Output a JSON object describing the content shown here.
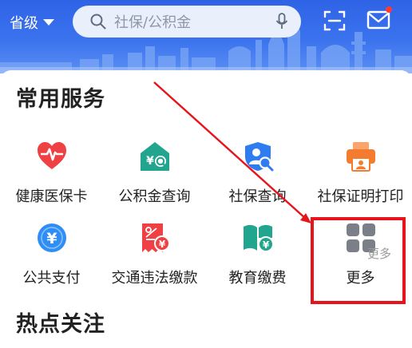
{
  "header": {
    "region_label": "省级",
    "search_placeholder": "社保/公积金"
  },
  "colors": {
    "header_blue": "#3b73ee",
    "icon_red": "#ef4143",
    "icon_teal": "#22a58f",
    "icon_blue": "#2f7bf0",
    "icon_orange": "#f57b2f",
    "icon_gray": "#7b8088",
    "highlight_red": "#e8141c"
  },
  "common_services": {
    "title": "常用服务",
    "items": [
      {
        "label": "健康医保卡",
        "icon": "heart-pulse-icon"
      },
      {
        "label": "公积金查询",
        "icon": "house-fund-search-icon"
      },
      {
        "label": "社保查询",
        "icon": "person-shield-search-icon"
      },
      {
        "label": "社保证明打印",
        "icon": "printer-icon"
      },
      {
        "label": "公共支付",
        "icon": "yuan-coin-icon"
      },
      {
        "label": "交通违法缴款",
        "icon": "traffic-fine-receipt-icon"
      },
      {
        "label": "教育缴费",
        "icon": "book-yuan-icon"
      },
      {
        "label": "更多",
        "icon": "four-squares-grid-icon"
      }
    ]
  },
  "hot_topics": {
    "title": "热点关注",
    "more_label": "更多"
  }
}
